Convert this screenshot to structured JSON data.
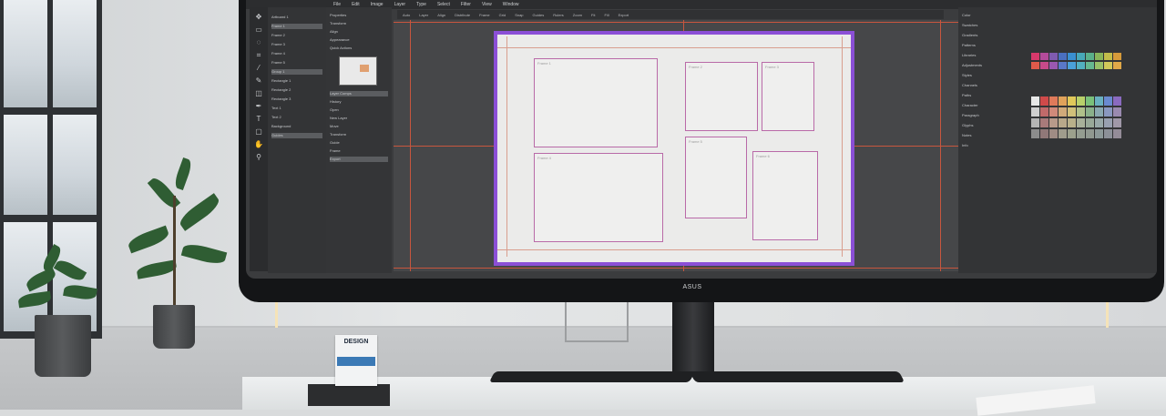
{
  "scene": {
    "description_tags": [
      "office",
      "curved-monitor",
      "design-app",
      "plants",
      "window"
    ]
  },
  "monitor": {
    "brand": "ASUS"
  },
  "app": {
    "menu_items": [
      "File",
      "Edit",
      "Image",
      "Layer",
      "Type",
      "Select",
      "Filter",
      "View",
      "Window"
    ],
    "options_items": [
      "Auto",
      "Layer",
      "Align",
      "Distribute",
      "Frame",
      "Grid",
      "Snap",
      "Guides",
      "Rulers",
      "Zoom",
      "Fit",
      "Fill",
      "Export"
    ],
    "tools": [
      "move",
      "marquee",
      "lasso",
      "crop",
      "eyedropper",
      "brush",
      "eraser",
      "pen",
      "type",
      "shape",
      "hand",
      "zoom"
    ],
    "layers": [
      {
        "label": "Artboard 1",
        "selected": false
      },
      {
        "label": "Frame 1",
        "selected": true
      },
      {
        "label": "Frame 2",
        "selected": false
      },
      {
        "label": "Frame 3",
        "selected": false
      },
      {
        "label": "Frame 4",
        "selected": false
      },
      {
        "label": "Frame 5",
        "selected": false
      },
      {
        "label": "Group 1",
        "selected": true
      },
      {
        "label": "Rectangle 1",
        "selected": false
      },
      {
        "label": "Rectangle 2",
        "selected": false
      },
      {
        "label": "Rectangle 3",
        "selected": false
      },
      {
        "label": "Text 1",
        "selected": false
      },
      {
        "label": "Text 2",
        "selected": false
      },
      {
        "label": "Background",
        "selected": false
      },
      {
        "label": "Guides",
        "selected": true
      }
    ],
    "properties": [
      {
        "label": "Properties",
        "selected": false
      },
      {
        "label": "Transform",
        "selected": false
      },
      {
        "label": "Align",
        "selected": false
      },
      {
        "label": "Appearance",
        "selected": false
      },
      {
        "label": "Quick Actions",
        "selected": false
      },
      {
        "label": "Layer Comps",
        "selected": true
      },
      {
        "label": "History",
        "selected": false
      },
      {
        "label": "Open",
        "selected": false
      },
      {
        "label": "New Layer",
        "selected": false
      },
      {
        "label": "Move",
        "selected": false
      },
      {
        "label": "Transform",
        "selected": false
      },
      {
        "label": "Guide",
        "selected": false
      },
      {
        "label": "Frame",
        "selected": false
      },
      {
        "label": "Export",
        "selected": true
      }
    ],
    "right_panel": {
      "items": [
        "Color",
        "Swatches",
        "Gradients",
        "Patterns",
        "Libraries",
        "Adjustments",
        "Styles",
        "Channels",
        "Paths",
        "Character",
        "Paragraph",
        "Glyphs",
        "Notes",
        "Info"
      ],
      "swatch_colors": [
        "#d8396b",
        "#b44b9a",
        "#7f5bb0",
        "#4a6fc0",
        "#3a8fd0",
        "#47a8b8",
        "#5ab08a",
        "#88b55a",
        "#c2bd4a",
        "#d69a3a",
        "#e05a4a",
        "#c84a8a",
        "#9a58b0",
        "#5a78c8",
        "#4aa0d8",
        "#52b0c0",
        "#66b890",
        "#98c068",
        "#d0c85a",
        "#e0a848"
      ],
      "palette_colors": [
        "#e8e8e8",
        "#d04a4a",
        "#e07a5a",
        "#e0a25a",
        "#e0c85a",
        "#b8d06a",
        "#7ac07a",
        "#6ab0c0",
        "#6a8ad0",
        "#8a6ac0",
        "#cfcfcf",
        "#c06a6a",
        "#d08a7a",
        "#d0aa7a",
        "#d0c07a",
        "#b0c08a",
        "#8ab08a",
        "#8aa8b0",
        "#8a98c0",
        "#9a8ab0",
        "#b4b4b4",
        "#a87a7a",
        "#b89a8a",
        "#b8a88a",
        "#b8b08a",
        "#a8b09a",
        "#98a898",
        "#98a8a8",
        "#98a0b0",
        "#a098a8",
        "#8c8c8c",
        "#907878",
        "#a08c84",
        "#a09c8c",
        "#9ca08c",
        "#949c90",
        "#909890",
        "#8c9898",
        "#8c9098",
        "#948c98"
      ]
    },
    "artboard": {
      "frames": [
        {
          "label": "Frame 1"
        },
        {
          "label": "Frame 2"
        },
        {
          "label": "Frame 3"
        },
        {
          "label": "Frame 4"
        },
        {
          "label": "Frame 5"
        },
        {
          "label": "Frame 6"
        }
      ]
    },
    "taskbar_icon_colors": [
      "#f0f0f0",
      "#3a8fd0",
      "#e0a83a",
      "#4aa048",
      "#d04a4a",
      "#8a6ac0",
      "#3a8fd0",
      "#e07a3a",
      "#5ab0b0",
      "#c84a8a",
      "#4a6fc0",
      "#d0c04a",
      "#6ab060",
      "#3a3a3a",
      "#8a8a8a"
    ]
  },
  "card": {
    "title": "DESIGN"
  }
}
